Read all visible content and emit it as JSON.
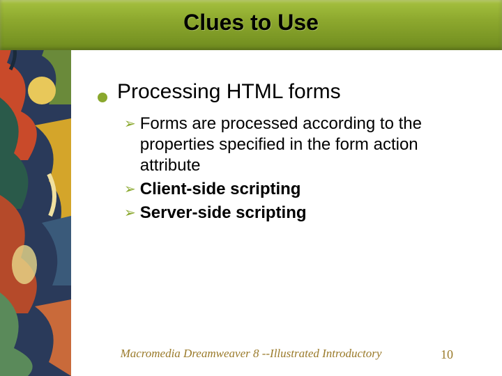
{
  "title": "Clues to Use",
  "main_bullet": "Processing HTML forms",
  "sub_items": [
    {
      "text": "Forms are processed according to the properties specified in the form action attribute",
      "bold": false
    },
    {
      "text": "Client-side scripting",
      "bold": true
    },
    {
      "text": "Server-side scripting",
      "bold": true
    }
  ],
  "footer": "Macromedia Dreamweaver 8 --Illustrated Introductory",
  "page": "10"
}
